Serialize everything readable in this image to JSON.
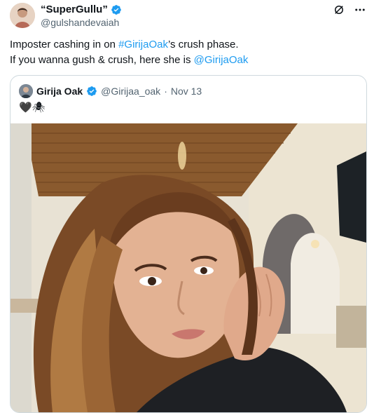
{
  "post": {
    "display_name": "“SuperGullu”",
    "handle": "@gulshandevaiah",
    "text_line1_before": "Imposter cashing in on ",
    "text_line1_hashtag": "#GirijaOak",
    "text_line1_after": "’s crush phase.",
    "text_line2_before": "If you wanna gush & crush, here she is ",
    "text_line2_mention": "@GirijaOak"
  },
  "quoted": {
    "display_name": "Girija Oak",
    "handle": "@Girijaa_oak",
    "separator": "·",
    "date": "Nov 13",
    "emoji_text": "🖤🕷"
  },
  "colors": {
    "link": "#1d9bf0",
    "verified": "#1d9bf0",
    "text": "#0f1419",
    "muted": "#536471",
    "border": "#cfd9de"
  },
  "icons": {
    "verified": "verified-badge-icon",
    "grok": "grok-icon",
    "more": "more-horizontal-icon"
  }
}
